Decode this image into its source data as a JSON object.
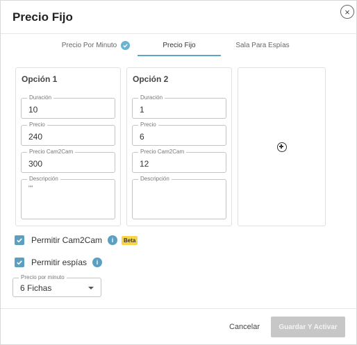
{
  "dialog": {
    "title": "Precio Fijo",
    "close_symbol": "×"
  },
  "tabs": [
    {
      "label": "Precio Por Minuto",
      "completed": true,
      "active": false
    },
    {
      "label": "Precio Fijo",
      "completed": false,
      "active": true
    },
    {
      "label": "Sala Para Espías",
      "completed": false,
      "active": false
    }
  ],
  "options": [
    {
      "title": "Opción 1",
      "duration_label": "Duración",
      "duration_value": "10",
      "price_label": "Precio",
      "price_value": "240",
      "cam2cam_label": "Precio Cam2Cam",
      "cam2cam_value": "300",
      "description_label": "Descripción",
      "description_value": "\"\""
    },
    {
      "title": "Opción 2",
      "duration_label": "Duración",
      "duration_value": "1",
      "price_label": "Precio",
      "price_value": "6",
      "cam2cam_label": "Precio Cam2Cam",
      "cam2cam_value": "12",
      "description_label": "Descripción",
      "description_value": ""
    }
  ],
  "add_option": {
    "icon": "plus-circle-icon"
  },
  "settings": {
    "allow_cam2cam_label": "Permitir Cam2Cam",
    "allow_cam2cam_checked": true,
    "beta_badge": "Beta",
    "allow_spies_label": "Permitir espías",
    "allow_spies_checked": true,
    "price_per_minute_label": "Precio por minuto",
    "price_per_minute_value": "6 Fichas"
  },
  "footer": {
    "cancel_label": "Cancelar",
    "save_label": "Guardar Y Activar"
  },
  "colors": {
    "accent": "#5b9fc1",
    "beta": "#f6d54a",
    "disabled_button": "#c7c7c7"
  }
}
